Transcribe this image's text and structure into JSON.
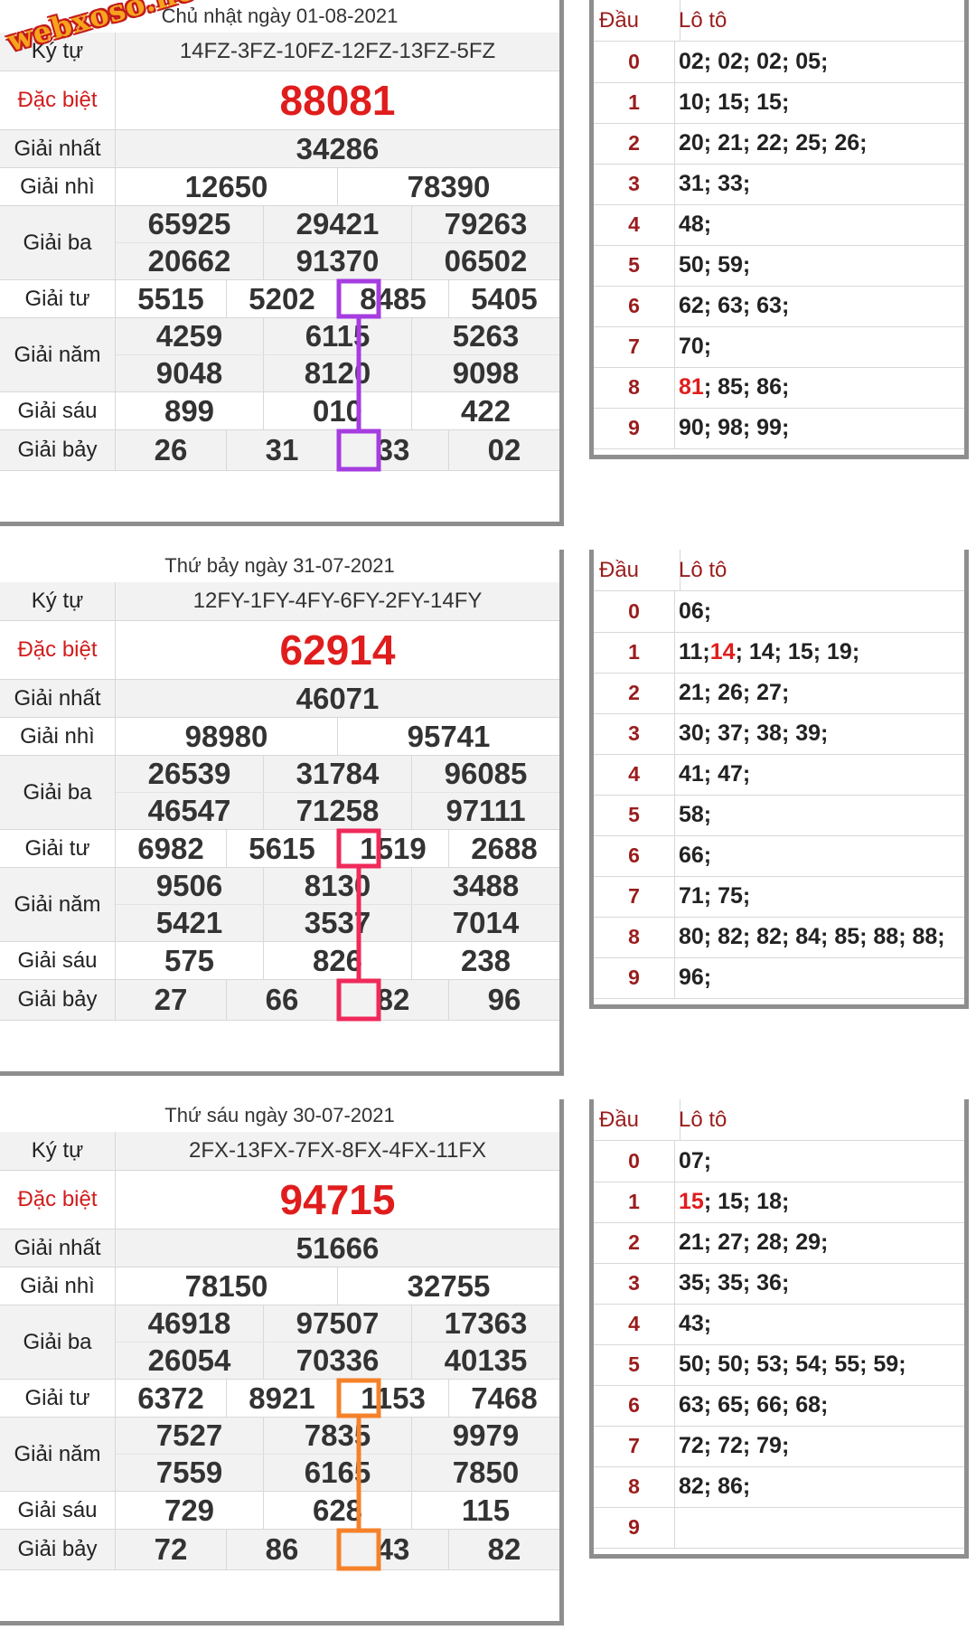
{
  "watermark": "webxoso.net",
  "results": [
    {
      "header": "Chủ nhật ngày 01-08-2021",
      "highlight_color": "#a63de0",
      "prizes": [
        {
          "label": "Ký tự",
          "rows": [
            [
              "14FZ-3FZ-10FZ-12FZ-13FZ-5FZ"
            ]
          ],
          "kind": "code"
        },
        {
          "label": "Đặc biệt",
          "rows": [
            [
              "88081"
            ]
          ],
          "kind": "special"
        },
        {
          "label": "Giải nhất",
          "rows": [
            [
              "34286"
            ]
          ]
        },
        {
          "label": "Giải nhì",
          "rows": [
            [
              "12650",
              "78390"
            ]
          ]
        },
        {
          "label": "Giải ba",
          "rows": [
            [
              "65925",
              "29421",
              "79263"
            ],
            [
              "20662",
              "91370",
              "06502"
            ]
          ]
        },
        {
          "label": "Giải tư",
          "rows": [
            [
              "5515",
              "5202",
              "8485",
              "5405"
            ]
          ]
        },
        {
          "label": "Giải năm",
          "rows": [
            [
              "4259",
              "6115",
              "5263"
            ],
            [
              "9048",
              "8120",
              "9098"
            ]
          ]
        },
        {
          "label": "Giải sáu",
          "rows": [
            [
              "899",
              "010",
              "422"
            ]
          ]
        },
        {
          "label": "Giải bảy",
          "rows": [
            [
              "26",
              "31",
              "33",
              "02"
            ]
          ]
        }
      ],
      "loto": {
        "head_label": "Đầu",
        "loto_label": "Lô tô",
        "rows": [
          {
            "d": "0",
            "v": "02; 02; 02; 05;"
          },
          {
            "d": "1",
            "v": "10; 15; 15;"
          },
          {
            "d": "2",
            "v": "20; 21; 22; 25; 26;"
          },
          {
            "d": "3",
            "v": "31; 33;"
          },
          {
            "d": "4",
            "v": "48;"
          },
          {
            "d": "5",
            "v": "50; 59;"
          },
          {
            "d": "6",
            "v": "62; 63; 63;"
          },
          {
            "d": "7",
            "v": "70;"
          },
          {
            "d": "8",
            "v": "81; 85; 86;",
            "hl": "81"
          },
          {
            "d": "9",
            "v": "90; 98; 99;"
          }
        ]
      }
    },
    {
      "header": "Thứ bảy ngày 31-07-2021",
      "highlight_color": "#ef2a5a",
      "prizes": [
        {
          "label": "Ký tự",
          "rows": [
            [
              "12FY-1FY-4FY-6FY-2FY-14FY"
            ]
          ],
          "kind": "code"
        },
        {
          "label": "Đặc biệt",
          "rows": [
            [
              "62914"
            ]
          ],
          "kind": "special"
        },
        {
          "label": "Giải nhất",
          "rows": [
            [
              "46071"
            ]
          ]
        },
        {
          "label": "Giải nhì",
          "rows": [
            [
              "98980",
              "95741"
            ]
          ]
        },
        {
          "label": "Giải ba",
          "rows": [
            [
              "26539",
              "31784",
              "96085"
            ],
            [
              "46547",
              "71258",
              "97111"
            ]
          ]
        },
        {
          "label": "Giải tư",
          "rows": [
            [
              "6982",
              "5615",
              "1519",
              "2688"
            ]
          ]
        },
        {
          "label": "Giải năm",
          "rows": [
            [
              "9506",
              "8130",
              "3488"
            ],
            [
              "5421",
              "3537",
              "7014"
            ]
          ]
        },
        {
          "label": "Giải sáu",
          "rows": [
            [
              "575",
              "826",
              "238"
            ]
          ]
        },
        {
          "label": "Giải bảy",
          "rows": [
            [
              "27",
              "66",
              "82",
              "96"
            ]
          ]
        }
      ],
      "loto": {
        "head_label": "Đầu",
        "loto_label": "Lô tô",
        "rows": [
          {
            "d": "0",
            "v": "06;"
          },
          {
            "d": "1",
            "v": "11; 14; 14; 15; 19;",
            "hl": "14"
          },
          {
            "d": "2",
            "v": "21; 26; 27;"
          },
          {
            "d": "3",
            "v": "30; 37; 38; 39;"
          },
          {
            "d": "4",
            "v": "41; 47;"
          },
          {
            "d": "5",
            "v": "58;"
          },
          {
            "d": "6",
            "v": "66;"
          },
          {
            "d": "7",
            "v": "71; 75;"
          },
          {
            "d": "8",
            "v": "80; 82; 82; 84; 85; 88; 88;"
          },
          {
            "d": "9",
            "v": "96;"
          }
        ]
      }
    },
    {
      "header": "Thứ sáu ngày 30-07-2021",
      "highlight_color": "#f5822a",
      "prizes": [
        {
          "label": "Ký tự",
          "rows": [
            [
              "2FX-13FX-7FX-8FX-4FX-11FX"
            ]
          ],
          "kind": "code"
        },
        {
          "label": "Đặc biệt",
          "rows": [
            [
              "94715"
            ]
          ],
          "kind": "special"
        },
        {
          "label": "Giải nhất",
          "rows": [
            [
              "51666"
            ]
          ]
        },
        {
          "label": "Giải nhì",
          "rows": [
            [
              "78150",
              "32755"
            ]
          ]
        },
        {
          "label": "Giải ba",
          "rows": [
            [
              "46918",
              "97507",
              "17363"
            ],
            [
              "26054",
              "70336",
              "40135"
            ]
          ]
        },
        {
          "label": "Giải tư",
          "rows": [
            [
              "6372",
              "8921",
              "1153",
              "7468"
            ]
          ]
        },
        {
          "label": "Giải năm",
          "rows": [
            [
              "7527",
              "7835",
              "9979"
            ],
            [
              "7559",
              "6165",
              "7850"
            ]
          ]
        },
        {
          "label": "Giải sáu",
          "rows": [
            [
              "729",
              "628",
              "115"
            ]
          ]
        },
        {
          "label": "Giải bảy",
          "rows": [
            [
              "72",
              "86",
              "43",
              "82"
            ]
          ]
        }
      ],
      "loto": {
        "head_label": "Đầu",
        "loto_label": "Lô tô",
        "rows": [
          {
            "d": "0",
            "v": "07;"
          },
          {
            "d": "1",
            "v": "15; 15; 18;",
            "hl": "15"
          },
          {
            "d": "2",
            "v": "21; 27; 28; 29;"
          },
          {
            "d": "3",
            "v": "35; 35; 36;"
          },
          {
            "d": "4",
            "v": "43;"
          },
          {
            "d": "5",
            "v": "50; 50; 53; 54; 55; 59;"
          },
          {
            "d": "6",
            "v": "63; 65; 66; 68;"
          },
          {
            "d": "7",
            "v": "72; 72; 79;"
          },
          {
            "d": "8",
            "v": "82; 86;"
          },
          {
            "d": "9",
            "v": ""
          }
        ]
      }
    }
  ]
}
